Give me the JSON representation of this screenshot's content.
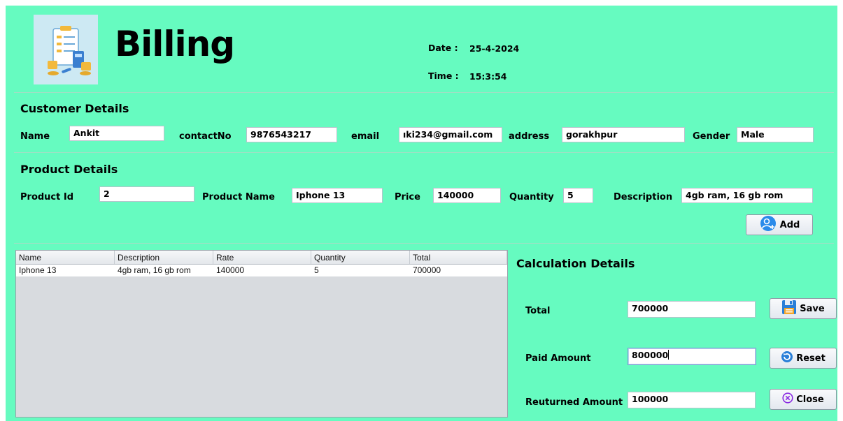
{
  "header": {
    "title": "Billing",
    "date_label": "Date :",
    "date_value": "25-4-2024",
    "time_label": "Time :",
    "time_value": "15:3:54"
  },
  "customer": {
    "heading": "Customer Details",
    "name_label": "Name",
    "name_value": "Ankit",
    "contact_label": "contactNo",
    "contact_value": "9876543217",
    "email_label": "email",
    "email_value": "ıki234@gmail.com",
    "address_label": "address",
    "address_value": "gorakhpur",
    "gender_label": "Gender",
    "gender_value": "Male"
  },
  "product": {
    "heading": "Product Details",
    "id_label": "Product Id",
    "id_value": "2",
    "name_label": "Product Name",
    "name_value": "Iphone 13",
    "price_label": "Price",
    "price_value": "140000",
    "quantity_label": "Quantity",
    "quantity_value": "5",
    "description_label": "Description",
    "description_value": "4gb ram, 16 gb rom",
    "add_label": "Add"
  },
  "table": {
    "columns": [
      "Name",
      "Description",
      "Rate",
      "Quantity",
      "Total"
    ],
    "rows": [
      [
        "Iphone 13",
        "4gb ram, 16 gb rom",
        "140000",
        "5",
        "700000"
      ]
    ]
  },
  "calculation": {
    "heading": "Calculation Details",
    "total_label": "Total",
    "total_value": "700000",
    "paid_label": "Paid Amount",
    "paid_value": "800000",
    "returned_label": "Reuturned Amount",
    "returned_value": "100000",
    "save_label": "Save",
    "reset_label": "Reset",
    "close_label": "Close"
  },
  "colors": {
    "background": "#66fbc0",
    "field_bg": "#ffffff",
    "table_bg": "#d8dbdf"
  },
  "icons": [
    "billing-logo",
    "add-user-icon",
    "save-icon",
    "reset-icon",
    "close-icon"
  ]
}
